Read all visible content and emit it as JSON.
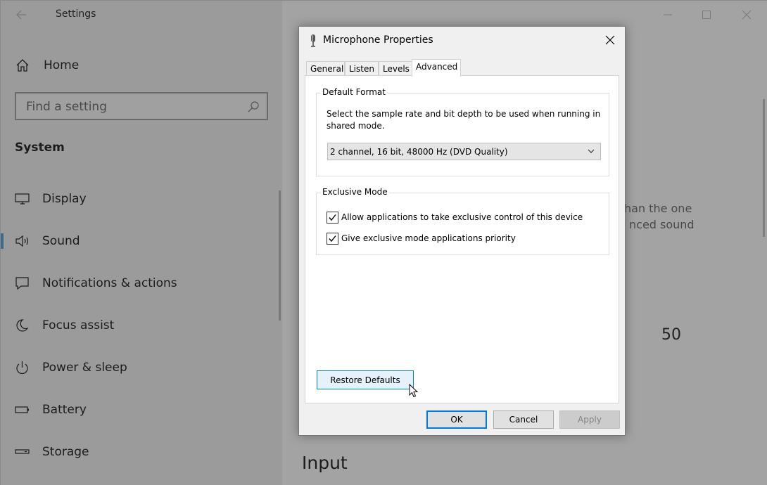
{
  "settings": {
    "title": "Settings",
    "home_label": "Home",
    "search_placeholder": "Find a setting",
    "section_header": "System",
    "nav_items": [
      {
        "label": "Display",
        "icon": "monitor-icon"
      },
      {
        "label": "Sound",
        "icon": "speaker-icon",
        "active": true
      },
      {
        "label": "Notifications & actions",
        "icon": "notification-icon"
      },
      {
        "label": "Focus assist",
        "icon": "moon-icon"
      },
      {
        "label": "Power & sleep",
        "icon": "power-icon"
      },
      {
        "label": "Battery",
        "icon": "battery-icon"
      },
      {
        "label": "Storage",
        "icon": "storage-icon"
      }
    ],
    "main": {
      "partial_text_1": "han the one",
      "partial_text_2": "nced sound",
      "volume_value": "50",
      "input_heading": "Input"
    }
  },
  "dialog": {
    "title": "Microphone Properties",
    "tabs": [
      "General",
      "Listen",
      "Levels",
      "Advanced"
    ],
    "selected_tab": "Advanced",
    "default_format": {
      "title": "Default Format",
      "description": "Select the sample rate and bit depth to be used when running in shared mode.",
      "selected_value": "2 channel, 16 bit, 48000 Hz (DVD Quality)"
    },
    "exclusive_mode": {
      "title": "Exclusive Mode",
      "options": [
        {
          "label": "Allow applications to take exclusive control of this device",
          "checked": true
        },
        {
          "label": "Give exclusive mode applications priority",
          "checked": true
        }
      ]
    },
    "restore_label": "Restore Defaults",
    "buttons": {
      "ok": "OK",
      "cancel": "Cancel",
      "apply": "Apply"
    }
  },
  "colors": {
    "accent": "#0078d7",
    "restore_bg": "#e5f1fb",
    "dim_overlay": "#9b9b9b"
  }
}
